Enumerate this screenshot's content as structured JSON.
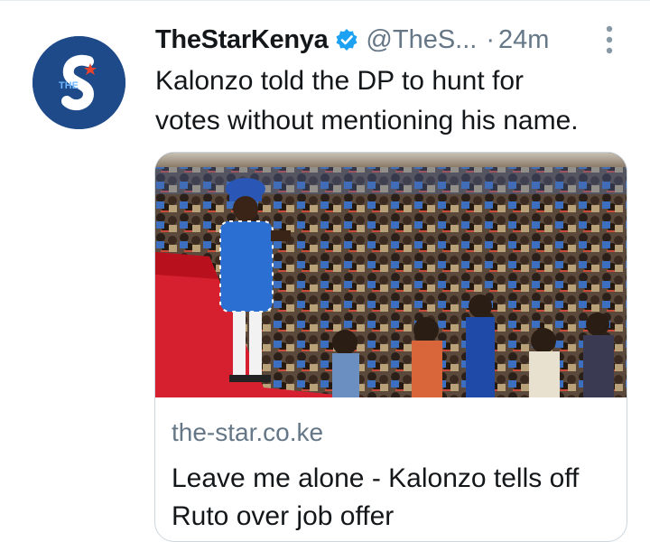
{
  "tweet": {
    "display_name": "TheStarKenya",
    "verified_icon": "verified-badge-icon",
    "handle": "@TheS...",
    "separator": "·",
    "time": "24m",
    "more_icon": "more-vertical-icon",
    "text_line1": "Kalonzo told the DP to hunt for",
    "text_line2": "votes without mentioning his name."
  },
  "avatar": {
    "icon": "the-star-logo-icon",
    "brand_color": "#1e4a8a",
    "accent_color": "#e8432e"
  },
  "card": {
    "image_icon": "rally-crowd-photo",
    "domain": "the-star.co.ke",
    "title": "Leave me alone - Kalonzo tells off Ruto over job offer"
  },
  "colors": {
    "verified": "#1da1f2",
    "secondary_text": "#657786",
    "primary_text": "#14171a",
    "card_border": "#ccd6dd"
  }
}
